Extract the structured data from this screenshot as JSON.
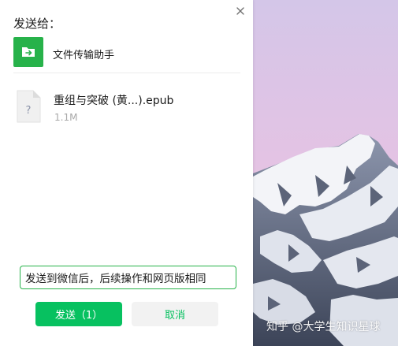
{
  "dialog": {
    "title": "发送给：",
    "recipient": {
      "name": "文件传输助手",
      "avatar_icon": "folder-arrow-icon",
      "avatar_color": "#27b24a"
    },
    "file": {
      "name": "重组与突破 (黄...).epub",
      "size": "1.1M",
      "icon": "unknown-file-icon"
    },
    "message_input": {
      "value": "发送到微信后，后续操作和网页版相同"
    },
    "buttons": {
      "send": "发送（1）",
      "cancel": "取消"
    }
  },
  "watermark": "知乎 @大学生知识星球",
  "colors": {
    "accent": "#07c160",
    "send_bg": "#07c160",
    "cancel_bg": "#f2f2f2"
  }
}
